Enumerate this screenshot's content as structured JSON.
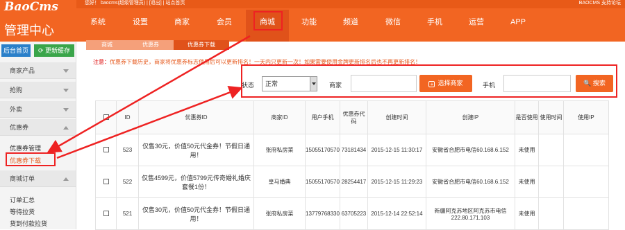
{
  "header": {
    "logo": "BaoCms",
    "admin_title": "管理中心",
    "welcome": "您好！ baocms(超级管理员) | [退出] | 站点首页",
    "right_text": "BAOCMS 支持论坛"
  },
  "nav": {
    "items": [
      "系统",
      "设置",
      "商家",
      "会员",
      "商城",
      "功能",
      "频道",
      "微信",
      "手机",
      "运营",
      "APP"
    ],
    "active_index": 4
  },
  "sidebar": {
    "home_button": "后台首页",
    "refresh_button": "更新缓存",
    "groups": [
      {
        "label": "商家产品",
        "state": "collapsed"
      },
      {
        "label": "抢购",
        "state": "collapsed"
      },
      {
        "label": "外卖",
        "state": "collapsed"
      },
      {
        "label": "优惠券",
        "state": "expanded"
      },
      {
        "label": "商城订单",
        "state": "expanded"
      }
    ],
    "coupon_items": [
      "优惠券管理",
      "优惠券下载"
    ],
    "order_items": [
      "订单汇总",
      "等待拉货",
      "货到付款拉货"
    ]
  },
  "breadcrumb": [
    "商城",
    "优惠券",
    "优惠券下载"
  ],
  "notice": {
    "prefix": "注意：",
    "text": "优惠券下载历史，商家将优惠券标志使用后可以更新排名！一天内只更新一次！如果需要使用金牌更新排名后也不再更新排名！"
  },
  "filter": {
    "status_label": "状态",
    "status_value": "正常",
    "merchant_label": "商家",
    "merchant_value": "",
    "select_merchant_button": "选择商家",
    "phone_label": "手机",
    "phone_value": "",
    "search_button": "搜索"
  },
  "table": {
    "columns": [
      "ID",
      "优惠券ID",
      "商家ID",
      "用户手机",
      "优惠券代码",
      "创建时间",
      "创建IP",
      "是否使用",
      "使用时间",
      "使用IP"
    ],
    "rows": [
      {
        "id": "523",
        "coupon": "仅售30元，价值50元代金券！节假日通用！",
        "merchant": "张府私房菜",
        "phone": "15055170570",
        "code": "73181434",
        "time": "2015-12-15 11:30:17",
        "ip": "安徽省合肥市电信60.168.6.152",
        "used": "未使用",
        "use_time": "",
        "use_ip": ""
      },
      {
        "id": "522",
        "coupon": "仅售4599元，价值5799元传奇婚礼婚庆套餐1份！",
        "merchant": "皇马婚典",
        "phone": "15055170570",
        "code": "28254417",
        "time": "2015-12-15 11:29:23",
        "ip": "安徽省合肥市电信60.168.6.152",
        "used": "未使用",
        "use_time": "",
        "use_ip": ""
      },
      {
        "id": "521",
        "coupon": "仅售30元，价值50元代金券！节假日通用！",
        "merchant": "张府私房菜",
        "phone": "13779768330",
        "code": "63705223",
        "time": "2015-12-14 22:52:14",
        "ip": "新疆阿克苏地区阿克苏市电信222.80.171.103",
        "used": "未使用",
        "use_time": "",
        "use_ip": ""
      }
    ]
  },
  "colors": {
    "brand": "#f26522",
    "annotation": "#ee2222"
  }
}
